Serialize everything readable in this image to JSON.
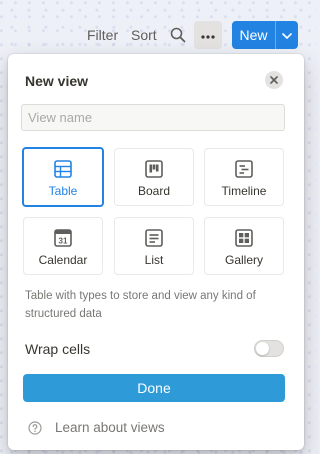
{
  "toolbar": {
    "filter_label": "Filter",
    "sort_label": "Sort",
    "new_label": "New",
    "search_icon": "search-icon",
    "more_icon": "more-horizontal-icon",
    "caret_icon": "chevron-down-icon"
  },
  "panel": {
    "title": "New view",
    "view_name_placeholder": "View name",
    "view_name_value": "",
    "view_types": [
      {
        "label": "Table",
        "icon": "table-icon",
        "selected": true
      },
      {
        "label": "Board",
        "icon": "board-icon",
        "selected": false
      },
      {
        "label": "Timeline",
        "icon": "timeline-icon",
        "selected": false
      },
      {
        "label": "Calendar",
        "icon": "calendar-icon",
        "selected": false,
        "icon_text": "31"
      },
      {
        "label": "List",
        "icon": "list-icon",
        "selected": false
      },
      {
        "label": "Gallery",
        "icon": "gallery-icon",
        "selected": false
      }
    ],
    "description": "Table with types to store and view any kind of structured data",
    "wrap_cells_label": "Wrap cells",
    "wrap_cells_on": false,
    "done_label": "Done",
    "learn_label": "Learn about views"
  },
  "colors": {
    "accent": "#2383e2",
    "done": "#2e9ad8",
    "muted_text": "#787774"
  }
}
